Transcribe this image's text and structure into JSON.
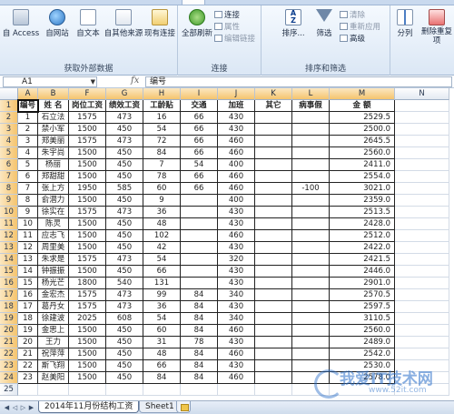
{
  "ribbon": {
    "groups": [
      {
        "label": "获取外部数据",
        "buttons": [
          "自 Access",
          "自网站",
          "自文本",
          "自其他来源",
          "现有连接"
        ]
      },
      {
        "label": "连接",
        "buttons": [
          "全部刷新"
        ],
        "small": [
          "连接",
          "属性",
          "编辑链接"
        ]
      },
      {
        "label": "排序和筛选",
        "buttons": [
          "排序...",
          "筛选"
        ],
        "small": [
          "清除",
          "重新应用",
          "高级"
        ]
      },
      {
        "buttons": [
          "分列",
          "删除重复项"
        ]
      }
    ]
  },
  "formula_bar": {
    "name_box": "A1",
    "fx": "fx",
    "content": "编号"
  },
  "grid": {
    "columns": [
      "A",
      "B",
      "F",
      "G",
      "H",
      "I",
      "J",
      "K",
      "L",
      "M",
      "N"
    ],
    "headers": [
      "编号",
      "姓 名",
      "岗位工资",
      "绩效工资",
      "工龄贴",
      "交通",
      "加班",
      "其它",
      "病事假",
      "金 额"
    ],
    "rows": [
      [
        "1",
        "石立法",
        "1575",
        "473",
        "16",
        "66",
        "430",
        "",
        "",
        "2529.5"
      ],
      [
        "2",
        "禁小军",
        "1500",
        "450",
        "54",
        "66",
        "430",
        "",
        "",
        "2500.0"
      ],
      [
        "3",
        "郑美丽",
        "1575",
        "473",
        "72",
        "66",
        "460",
        "",
        "",
        "2645.5"
      ],
      [
        "4",
        "朱宇尚",
        "1500",
        "450",
        "84",
        "66",
        "460",
        "",
        "",
        "2560.0"
      ],
      [
        "5",
        "杨丽",
        "1500",
        "450",
        "7",
        "54",
        "400",
        "",
        "",
        "2411.0"
      ],
      [
        "6",
        "郑甜甜",
        "1500",
        "450",
        "78",
        "66",
        "460",
        "",
        "",
        "2554.0"
      ],
      [
        "7",
        "张上方",
        "1950",
        "585",
        "60",
        "66",
        "460",
        "",
        "-100",
        "3021.0"
      ],
      [
        "8",
        "俞潜力",
        "1500",
        "450",
        "9",
        "",
        "400",
        "",
        "",
        "2359.0"
      ],
      [
        "9",
        "徐实在",
        "1575",
        "473",
        "36",
        "",
        "430",
        "",
        "",
        "2513.5"
      ],
      [
        "10",
        "陈灵",
        "1500",
        "450",
        "48",
        "",
        "430",
        "",
        "",
        "2428.0"
      ],
      [
        "11",
        "应志飞",
        "1500",
        "450",
        "102",
        "",
        "460",
        "",
        "",
        "2512.0"
      ],
      [
        "12",
        "周里美",
        "1500",
        "450",
        "42",
        "",
        "430",
        "",
        "",
        "2422.0"
      ],
      [
        "13",
        "朱求是",
        "1575",
        "473",
        "54",
        "",
        "320",
        "",
        "",
        "2421.5"
      ],
      [
        "14",
        "钟振振",
        "1500",
        "450",
        "66",
        "",
        "430",
        "",
        "",
        "2446.0"
      ],
      [
        "15",
        "杨光芒",
        "1800",
        "540",
        "131",
        "",
        "430",
        "",
        "",
        "2901.0"
      ],
      [
        "16",
        "金宏杰",
        "1575",
        "473",
        "99",
        "84",
        "340",
        "",
        "",
        "2570.5"
      ],
      [
        "17",
        "葛丹女",
        "1575",
        "473",
        "36",
        "84",
        "430",
        "",
        "",
        "2597.5"
      ],
      [
        "18",
        "徐建波",
        "2025",
        "608",
        "54",
        "84",
        "340",
        "",
        "",
        "3110.5"
      ],
      [
        "19",
        "金思上",
        "1500",
        "450",
        "60",
        "84",
        "460",
        "",
        "",
        "2560.0"
      ],
      [
        "20",
        "王力",
        "1500",
        "450",
        "31",
        "78",
        "430",
        "",
        "",
        "2489.0"
      ],
      [
        "21",
        "祝萍萍",
        "1500",
        "450",
        "48",
        "84",
        "460",
        "",
        "",
        "2542.0"
      ],
      [
        "22",
        "斯飞翔",
        "1500",
        "450",
        "66",
        "84",
        "430",
        "",
        "",
        "2530.0"
      ],
      [
        "23",
        "赵美阳",
        "1500",
        "450",
        "84",
        "84",
        "460",
        "",
        "",
        "2578.0"
      ]
    ],
    "row_numbers": [
      "1",
      "2",
      "3",
      "4",
      "5",
      "6",
      "7",
      "8",
      "9",
      "10",
      "11",
      "12",
      "13",
      "14",
      "15",
      "16",
      "17",
      "18",
      "19",
      "20",
      "21",
      "22",
      "23",
      "24",
      "25"
    ]
  },
  "sheet_tabs": [
    "2014年11月份结构工资",
    "Sheet1"
  ],
  "watermark": {
    "main": "我爱IT技术网",
    "sub": "www.52it.com"
  }
}
